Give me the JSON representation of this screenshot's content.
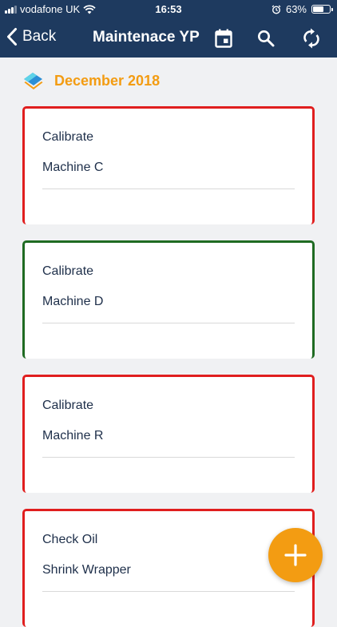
{
  "status_bar": {
    "carrier": "vodafone UK",
    "time": "16:53",
    "battery": "63%",
    "battery_level": 0.63
  },
  "nav": {
    "back_label": "Back",
    "title": "Maintenace YP"
  },
  "month": {
    "label": "December 2018"
  },
  "cards": [
    {
      "task": "Calibrate",
      "machine": "Machine C",
      "status_color": "#e01e1e"
    },
    {
      "task": "Calibrate",
      "machine": "Machine D",
      "status_color": "#1f6b22"
    },
    {
      "task": "Calibrate",
      "machine": "Machine R",
      "status_color": "#e01e1e"
    },
    {
      "task": "Check Oil",
      "machine": "Shrink Wrapper",
      "status_color": "#e01e1e"
    }
  ],
  "colors": {
    "nav_background": "#1e3a5f",
    "accent": "#f39c12",
    "alert": "#e01e1e",
    "ok": "#1f6b22"
  }
}
